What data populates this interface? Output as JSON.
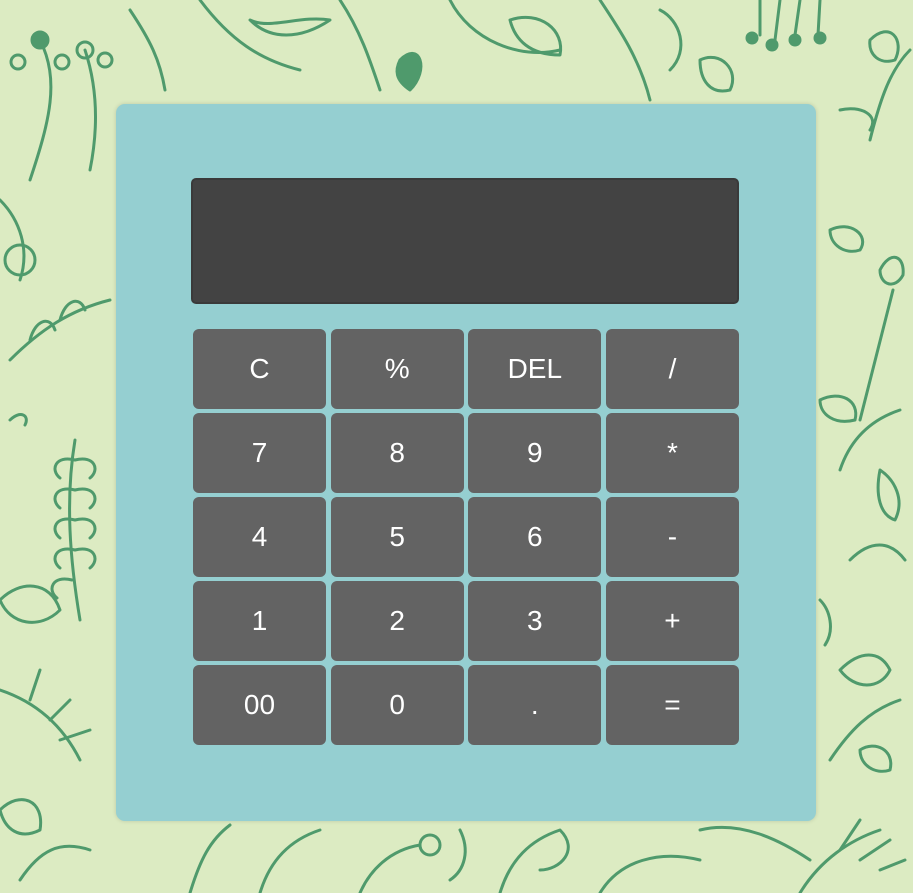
{
  "colors": {
    "background": "#dcebc2",
    "doodle_stroke": "#4f9a6c",
    "calculator_body": "#95cfd1",
    "display": "#434343",
    "key": "#636363",
    "key_text": "#ffffff"
  },
  "display": {
    "value": ""
  },
  "keys": [
    {
      "label": "C"
    },
    {
      "label": "%"
    },
    {
      "label": "DEL"
    },
    {
      "label": "/"
    },
    {
      "label": "7"
    },
    {
      "label": "8"
    },
    {
      "label": "9"
    },
    {
      "label": "*"
    },
    {
      "label": "4"
    },
    {
      "label": "5"
    },
    {
      "label": "6"
    },
    {
      "label": "-"
    },
    {
      "label": "1"
    },
    {
      "label": "2"
    },
    {
      "label": "3"
    },
    {
      "label": "+"
    },
    {
      "label": "00"
    },
    {
      "label": "0"
    },
    {
      "label": "."
    },
    {
      "label": "="
    }
  ]
}
